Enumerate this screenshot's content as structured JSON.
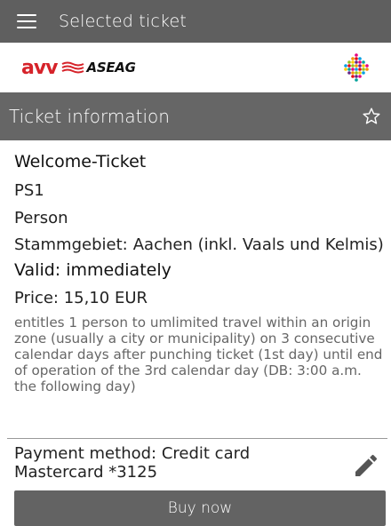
{
  "appbar": {
    "title": "Selected ticket",
    "menu_icon": "hamburger-menu-icon"
  },
  "brand": {
    "avv": "avv",
    "aseag": "ASEAG",
    "colors": {
      "avv": "#d6232a",
      "aseag": "#111111"
    }
  },
  "section": {
    "title": "Ticket information",
    "favorite_icon": "star-outline-icon"
  },
  "ticket": {
    "name": "Welcome-Ticket",
    "class": "PS1",
    "type": "Person",
    "zone_label": "Stammgebiet:",
    "zone_value": "Aachen (inkl. Vaals und Kelmis)",
    "valid": "Valid: immediately",
    "price": "Price: 15,10 EUR",
    "description": "entitles 1 person to umlimited travel within an origin zone (usually a city or municipality) on 3 consecutive calendar days after punching ticket (1st day) until end of operation of the 3rd calendar day (DB: 3:00 a.m. the following day)"
  },
  "payment": {
    "method": "Payment method: Credit card",
    "card": "Mastercard *3125",
    "edit_icon": "pencil-icon"
  },
  "actions": {
    "buy_label": "Buy now"
  },
  "colors": {
    "appbar": "#5f5f5f",
    "section_header": "#666666",
    "button": "#636363"
  }
}
